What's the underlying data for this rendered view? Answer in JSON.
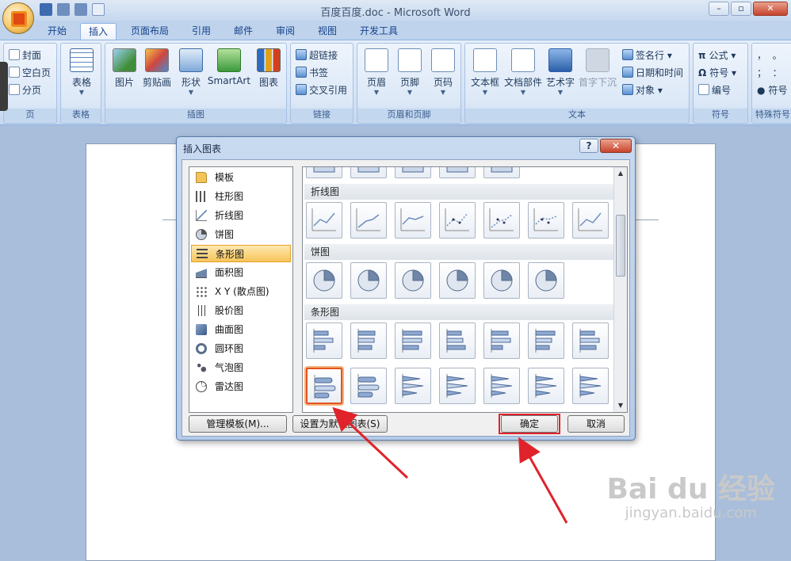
{
  "window": {
    "title": "百度百度.doc - Microsoft Word",
    "controls": {
      "minimize": "–",
      "restore": "▫",
      "close": "✕"
    }
  },
  "tabs": [
    {
      "label": "开始"
    },
    {
      "label": "插入"
    },
    {
      "label": "页面布局"
    },
    {
      "label": "引用"
    },
    {
      "label": "邮件"
    },
    {
      "label": "审阅"
    },
    {
      "label": "视图"
    },
    {
      "label": "开发工具"
    }
  ],
  "ribbon": {
    "page_group": {
      "label": "页",
      "cover": "封面",
      "blank_page": "空白页",
      "page_break": "分页"
    },
    "table_group": {
      "label": "表格",
      "table": "表格"
    },
    "illustrations_group": {
      "label": "插图",
      "picture": "图片",
      "clipart": "剪贴画",
      "shapes": "形状",
      "smartart": "SmartArt",
      "chart": "图表"
    },
    "links_group": {
      "label": "链接",
      "hyperlink": "超链接",
      "bookmark": "书签",
      "crossref": "交叉引用"
    },
    "header_footer_group": {
      "label": "页眉和页脚",
      "header": "页眉",
      "footer": "页脚",
      "page_number": "页码"
    },
    "text_group": {
      "label": "文本",
      "textbox": "文本框",
      "quickparts": "文档部件",
      "wordart": "艺术字",
      "dropcap": "首字下沉",
      "signature": "签名行",
      "datetime": "日期和时间",
      "object": "对象"
    },
    "symbols_group": {
      "label": "符号",
      "equation": "公式",
      "symbol": "符号",
      "numbering": "编号"
    },
    "special_group": {
      "label": "特殊符号",
      "symbol": "符号"
    }
  },
  "dialog": {
    "title": "插入图表",
    "help": "?",
    "close": "✕",
    "categories": [
      {
        "label": "模板",
        "icon": "folder-icon"
      },
      {
        "label": "柱形图",
        "icon": "column-chart-icon"
      },
      {
        "label": "折线图",
        "icon": "line-chart-icon"
      },
      {
        "label": "饼图",
        "icon": "pie-chart-icon"
      },
      {
        "label": "条形图",
        "icon": "bar-chart-icon"
      },
      {
        "label": "面积图",
        "icon": "area-chart-icon"
      },
      {
        "label": "X Y (散点图)",
        "icon": "scatter-chart-icon"
      },
      {
        "label": "股价图",
        "icon": "stock-chart-icon"
      },
      {
        "label": "曲面图",
        "icon": "surface-chart-icon"
      },
      {
        "label": "圆环图",
        "icon": "doughnut-chart-icon"
      },
      {
        "label": "气泡图",
        "icon": "bubble-chart-icon"
      },
      {
        "label": "雷达图",
        "icon": "radar-chart-icon"
      }
    ],
    "selected_category": "条形图",
    "sections": {
      "line": "折线图",
      "pie": "饼图",
      "bar": "条形图"
    },
    "buttons": {
      "manage_templates": "管理模板(M)...",
      "set_default": "设置为默认图表(S)",
      "ok": "确定",
      "cancel": "取消"
    }
  },
  "watermark": {
    "main": "Bai du 经验",
    "sub": "jingyan.baidu.com"
  },
  "colors": {
    "annotation_red": "#e0232b",
    "selected_orange": "#f7c45a",
    "ribbon_blue": "#d3e2f5"
  }
}
